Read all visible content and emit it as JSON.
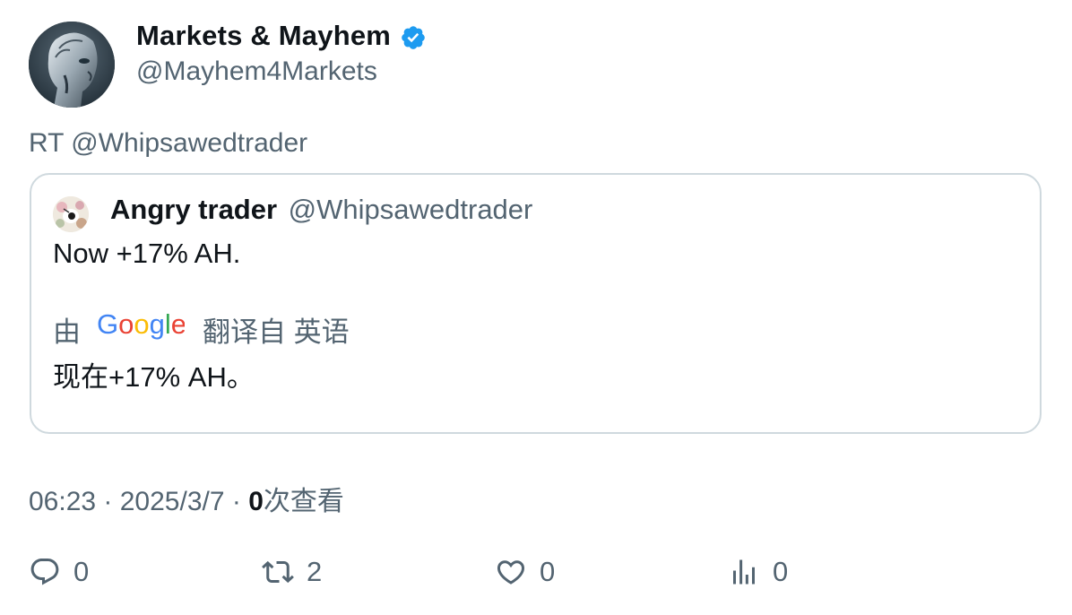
{
  "author": {
    "display_name": "Markets & Mayhem",
    "handle": "@Mayhem4Markets",
    "verified_color": "#1d9bf0"
  },
  "retweet_line": "RT @Whipsawedtrader",
  "quote": {
    "name": "Angry trader",
    "handle": "@Whipsawedtrader",
    "text": "Now +17% AH.",
    "translate_prefix": "由",
    "translate_brand": "Google",
    "translate_suffix": "翻译自 英语",
    "translated_text": "现在+17% AH。"
  },
  "meta": {
    "time": "06:23",
    "sep1": " · ",
    "date": "2025/3/7",
    "sep2": " · ",
    "views_count": "0",
    "views_label": "次查看"
  },
  "actions": {
    "reply_count": "0",
    "retweet_count": "2",
    "like_count": "0",
    "views_count": "0"
  },
  "colors": {
    "text_primary": "#0f1419",
    "text_secondary": "#536471",
    "border": "#cfd9de"
  },
  "icons": [
    "verified-badge-icon",
    "reply-icon",
    "retweet-icon",
    "like-icon",
    "analytics-icon"
  ]
}
